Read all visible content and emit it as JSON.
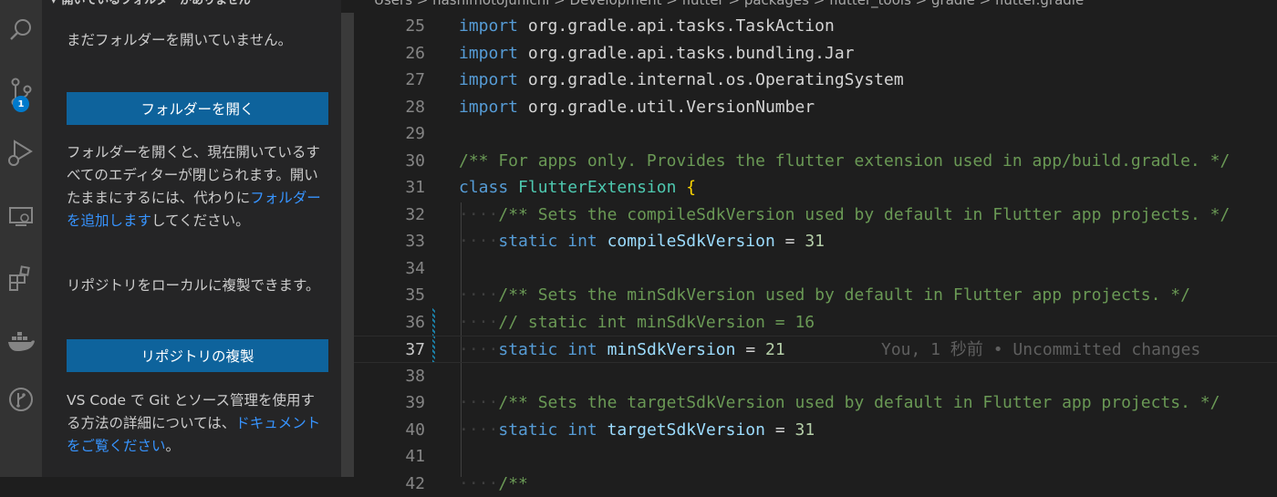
{
  "sidebar": {
    "header": "開いているフォルダーがありません",
    "intro": "まだフォルダーを開いていません。",
    "open_folder_button": "フォルダーを開く",
    "note_part1": "フォルダーを開くと、現在開いているすべてのエディターが閉じられます。開いたままにするには、代わりに",
    "note_link": "フォルダーを追加します",
    "note_part2": "してください。",
    "clone_note": "リポジトリをローカルに複製できます。",
    "clone_button": "リポジトリの複製",
    "docs_part1": "VS Code で Git とソース管理を使用する方法の詳細については、",
    "docs_link": "ドキュメントをご覧ください",
    "docs_part2": "。"
  },
  "activity_bar": {
    "icons": [
      "search-icon",
      "source-control-icon",
      "run-debug-icon",
      "remote-explorer-icon",
      "extensions-icon",
      "docker-icon",
      "git-graph-icon"
    ],
    "source_control_badge": "1"
  },
  "breadcrumb": {
    "items": [
      "Users",
      "hashimotojunichi",
      "Development",
      "flutter",
      "packages",
      "flutter_tools",
      "gradle",
      "flutter.gradle"
    ],
    "text": "Users > hashimotojunichi > Development > flutter > packages > flutter_tools > gradle > flutter.gradle"
  },
  "editor": {
    "active_line": 37,
    "line_numbers": [
      "25",
      "26",
      "27",
      "28",
      "29",
      "30",
      "31",
      "32",
      "33",
      "34",
      "35",
      "36",
      "37",
      "38",
      "39",
      "40",
      "41",
      "42"
    ],
    "code": {
      "l25_kw": "import",
      "l25_rest": " org.gradle.api.tasks.TaskAction",
      "l26_kw": "import",
      "l26_rest": " org.gradle.api.tasks.bundling.Jar",
      "l27_kw": "import",
      "l27_rest": " org.gradle.internal.os.OperatingSystem",
      "l28_kw": "import",
      "l28_rest": " org.gradle.util.VersionNumber",
      "l30_comment": "/** For apps only. Provides the flutter extension used in app/build.gradle. */",
      "l31_kw": "class",
      "l31_type": "FlutterExtension",
      "l31_brace": "{",
      "indent": "····",
      "l32_comment": "/** Sets the compileSdkVersion used by default in Flutter app projects. */",
      "static_kw": "static",
      "int_kw": "int",
      "eq": " = ",
      "l33_var": "compileSdkVersion",
      "l33_num": "31",
      "l35_comment": "/** Sets the minSdkVersion used by default in Flutter app projects. */",
      "l36_comment": "// static int minSdkVersion = 16",
      "l37_var": "minSdkVersion",
      "l37_num": "21",
      "l39_comment": "/** Sets the targetSdkVersion used by default in Flutter app projects. */",
      "l40_var": "targetSdkVersion",
      "l40_num": "31",
      "l42_comment": "/**"
    },
    "blame": "You, 1 秒前 • Uncommitted changes"
  },
  "colors": {
    "keyword": "#569cd6",
    "type": "#4ec9b0",
    "variable": "#9cdcfe",
    "number": "#b5cea8",
    "comment": "#6a9955",
    "button": "#0e639c",
    "link": "#3794ff",
    "badge": "#007acc"
  }
}
